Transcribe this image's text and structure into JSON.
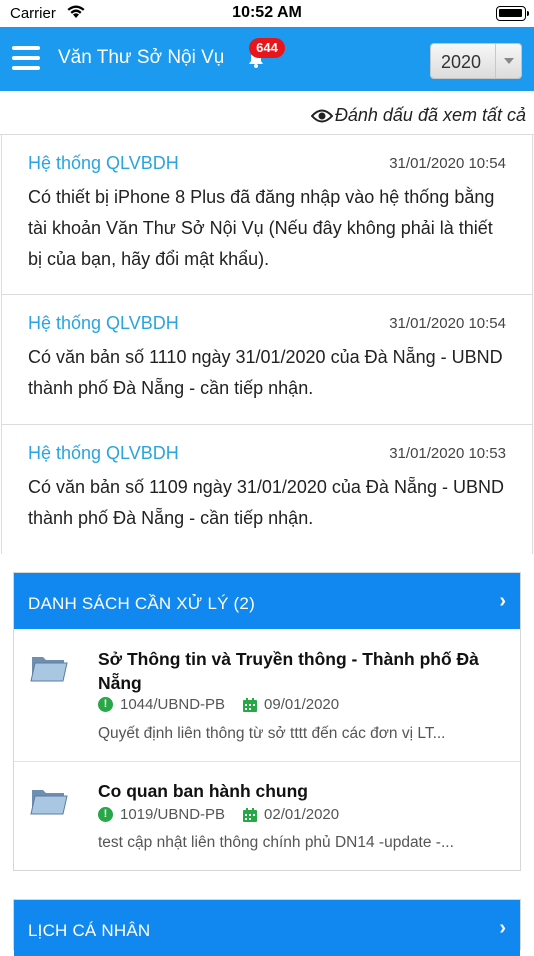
{
  "status_bar": {
    "carrier": "Carrier",
    "time": "10:52 AM"
  },
  "navbar": {
    "title": "Văn Thư Sở Nội Vụ",
    "badge": "644",
    "year": "2020"
  },
  "mark_all_label": "Đánh dấu đã xem tất cả",
  "notifications": [
    {
      "sender": "Hệ thống QLVBDH",
      "date": "31/01/2020 10:54",
      "body": "Có thiết bị iPhone 8 Plus đã đăng nhập vào hệ thống bằng tài khoản Văn Thư Sở Nội Vụ (Nếu đây không phải là thiết bị của bạn, hãy đổi mật khẩu)."
    },
    {
      "sender": "Hệ thống QLVBDH",
      "date": "31/01/2020 10:54",
      "body": "Có văn bản số 1110 ngày 31/01/2020 của Đà Nẵng - UBND thành phố Đà Nẵng - cần tiếp nhận."
    },
    {
      "sender": "Hệ thống QLVBDH",
      "date": "31/01/2020 10:53",
      "body": "Có văn bản số 1109 ngày 31/01/2020 của Đà Nẵng - UBND thành phố Đà Nẵng - cần tiếp nhận."
    }
  ],
  "todo_panel": {
    "title": "DANH SÁCH CẦN XỬ LÝ (2)",
    "items": [
      {
        "title": "Sở Thông tin và Truyền thông - Thành phố Đà Nẵng",
        "code": "1044/UBND-PB",
        "date": "09/01/2020",
        "desc": "Quyết định liên thông từ sở tttt đến các đơn vị LT..."
      },
      {
        "title": "Co quan ban hành chung",
        "code": "1019/UBND-PB",
        "date": "02/01/2020",
        "desc": "test cập nhật liên thông chính phủ DN14 -update -..."
      }
    ]
  },
  "calendar_panel": {
    "title": "LỊCH CÁ NHÂN"
  },
  "colors": {
    "nav_blue": "#1b9af0",
    "panel_blue": "#1088f0",
    "sender_blue": "#2aa4df",
    "badge_red": "#e8151b",
    "status_green": "#27a745"
  }
}
